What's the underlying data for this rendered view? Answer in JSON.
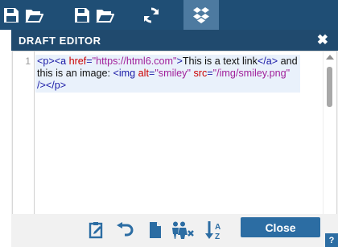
{
  "topbar": {
    "icons": [
      "save-icon",
      "open-folder-icon",
      "save-icon",
      "open-folder-icon",
      "refresh-icon",
      "dropbox-icon"
    ],
    "background": "#1f4e75",
    "active_background": "#4d7aa0"
  },
  "panel": {
    "title": "DRAFT EDITOR",
    "close_glyph": "✖"
  },
  "editor": {
    "line_number": "1",
    "code_segments": [
      {
        "kind": "tag",
        "text": "<p><a "
      },
      {
        "kind": "attr",
        "text": "href"
      },
      {
        "kind": "tag",
        "text": "="
      },
      {
        "kind": "str",
        "text": "\"https://html6.com\""
      },
      {
        "kind": "tag",
        "text": ">"
      },
      {
        "kind": "text",
        "text": "This is a text link"
      },
      {
        "kind": "tag",
        "text": "</a>"
      },
      {
        "kind": "text",
        "text": " and this is an image: "
      },
      {
        "kind": "tag",
        "text": "<img "
      },
      {
        "kind": "attr",
        "text": "alt"
      },
      {
        "kind": "tag",
        "text": "="
      },
      {
        "kind": "str",
        "text": "\"smiley\""
      },
      {
        "kind": "text",
        "text": " "
      },
      {
        "kind": "attr",
        "text": "src"
      },
      {
        "kind": "tag",
        "text": "="
      },
      {
        "kind": "str",
        "text": "\"/img/smiley.png\""
      },
      {
        "kind": "text",
        "text": " "
      },
      {
        "kind": "tag",
        "text": "/></p>"
      }
    ]
  },
  "toolbar": {
    "icons": [
      "clipboard-edit-icon",
      "undo-icon",
      "new-file-icon",
      "people-filter-icon",
      "sort-az-icon"
    ],
    "close_label": "Close",
    "help_label": "?"
  },
  "colors": {
    "accent": "#2c6da3",
    "header": "#204a6e",
    "tag": "#1a1aa6",
    "attr": "#cc0000",
    "string": "#a11f9a"
  }
}
